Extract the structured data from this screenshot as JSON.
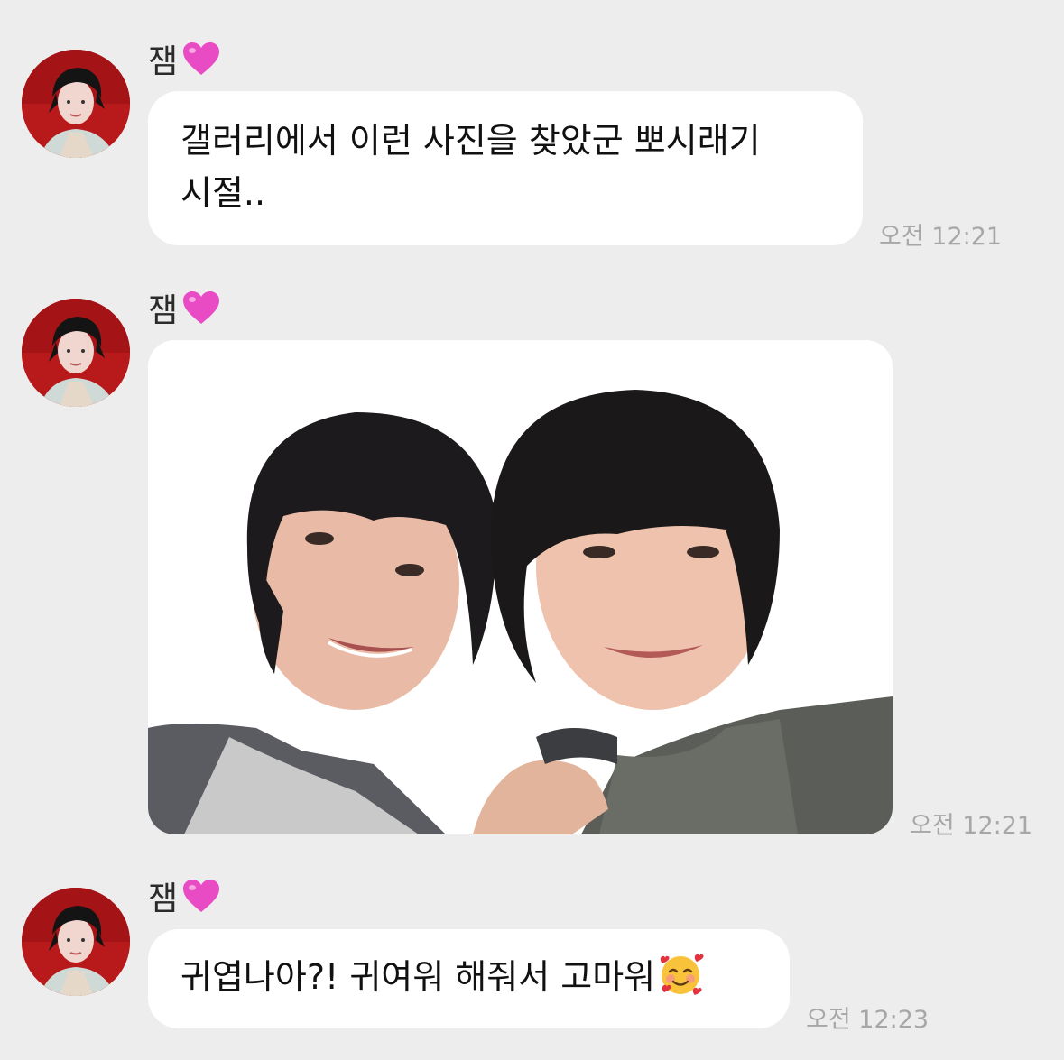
{
  "conversation": {
    "messages": [
      {
        "sender": "잼",
        "avatar": "profile-photo",
        "text_line1": "갤러리에서 이런 사진을 찾았군 뽀시래기",
        "text_line2": "시절..",
        "time": "오전 12:21"
      },
      {
        "sender": "잼",
        "avatar": "profile-photo",
        "attachment": "photo",
        "time": "오전 12:21"
      },
      {
        "sender": "잼",
        "avatar": "profile-photo",
        "text": "귀엽나아?! 귀여워 해줘서 고마워",
        "emoji": "smiling-face-with-hearts",
        "time": "오전 12:23"
      }
    ]
  },
  "colors": {
    "background": "#ededed",
    "bubble": "#ffffff",
    "avatar_bg": "#b8191b",
    "heart": "#e84bc4",
    "timestamp": "#a7a7a7"
  },
  "icons": {
    "sender_suffix": "pink-heart-icon"
  }
}
